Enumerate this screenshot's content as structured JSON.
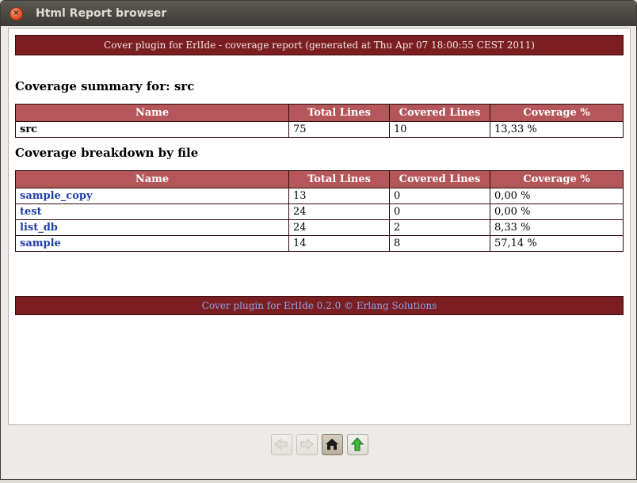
{
  "window": {
    "title": "Html Report browser",
    "close_glyph": "×"
  },
  "report": {
    "header": "Cover plugin for ErlIde - coverage report (generated at Thu Apr 07 18:00:55 CEST 2011)",
    "summary_heading": "Coverage summary for: src",
    "breakdown_heading": "Coverage breakdown by file",
    "columns": [
      "Name",
      "Total Lines",
      "Covered Lines",
      "Coverage %"
    ],
    "summary_rows": [
      {
        "name": "src",
        "total": "75",
        "covered": "10",
        "coverage": "13,33 %"
      }
    ],
    "file_rows": [
      {
        "name": "sample_copy",
        "total": "13",
        "covered": "0",
        "coverage": "0,00 %"
      },
      {
        "name": "test",
        "total": "24",
        "covered": "0",
        "coverage": "0,00 %"
      },
      {
        "name": "list_db",
        "total": "24",
        "covered": "2",
        "coverage": "8,33 %"
      },
      {
        "name": "sample",
        "total": "14",
        "covered": "8",
        "coverage": "57,14 %"
      }
    ],
    "footer": "Cover plugin for ErlIde 0.2.0 © Erlang Solutions"
  },
  "nav": {
    "back": {
      "icon": "back-arrow-icon",
      "enabled": false
    },
    "forward": {
      "icon": "forward-arrow-icon",
      "enabled": false
    },
    "home": {
      "icon": "home-icon",
      "enabled": true
    },
    "up": {
      "icon": "up-arrow-icon",
      "enabled": true
    }
  },
  "colors": {
    "header_bg": "#7b1e21",
    "table_header_bg": "#b5575a",
    "link": "#1f3fa6",
    "footer_text": "#8fa4e6"
  }
}
